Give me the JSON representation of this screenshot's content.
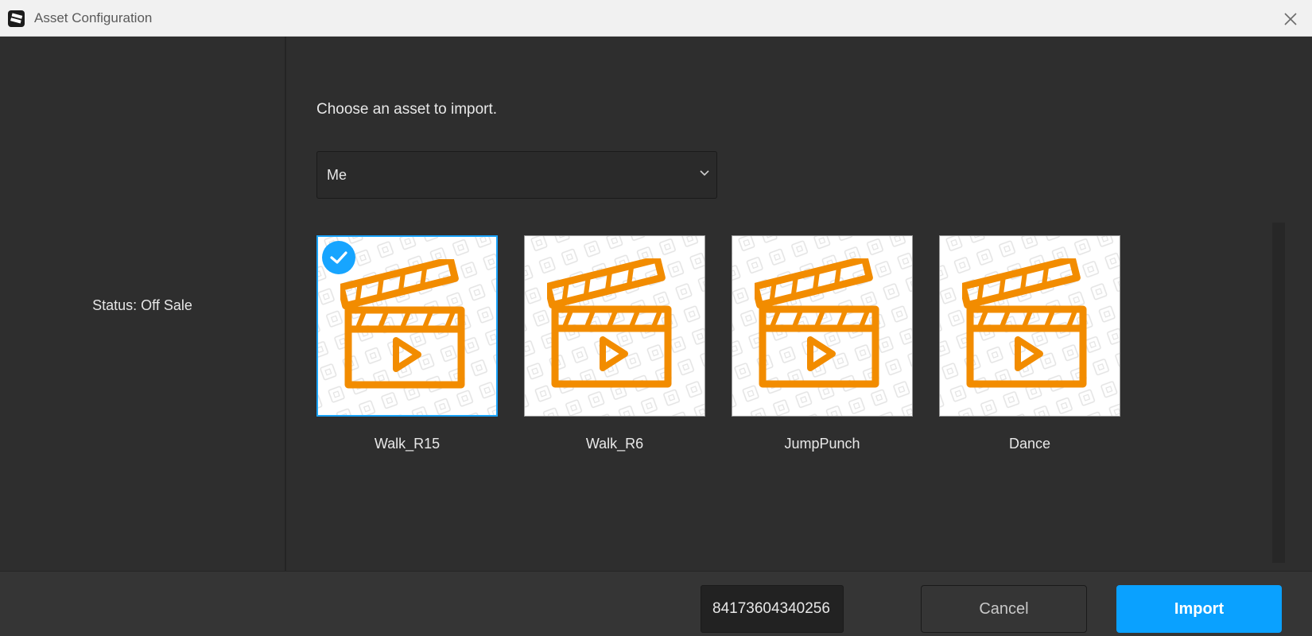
{
  "window": {
    "title": "Asset Configuration"
  },
  "left_panel": {
    "status": "Status: Off Sale"
  },
  "main": {
    "prompt": "Choose an asset to import.",
    "owner_select": {
      "value": "Me"
    },
    "assets": [
      {
        "label": "Walk_R15",
        "selected": true,
        "icon": "clapperboard-icon"
      },
      {
        "label": "Walk_R6",
        "selected": false,
        "icon": "clapperboard-icon"
      },
      {
        "label": "JumpPunch",
        "selected": false,
        "icon": "clapperboard-icon"
      },
      {
        "label": "Dance",
        "selected": false,
        "icon": "clapperboard-icon"
      }
    ]
  },
  "footer": {
    "asset_id_value": "84173604340256",
    "cancel_label": "Cancel",
    "import_label": "Import"
  },
  "colors": {
    "accent": "#0aa1ff",
    "icon_orange": "#f28c00",
    "background": "#2e2e2e",
    "titlebar": "#f1f1f1"
  }
}
